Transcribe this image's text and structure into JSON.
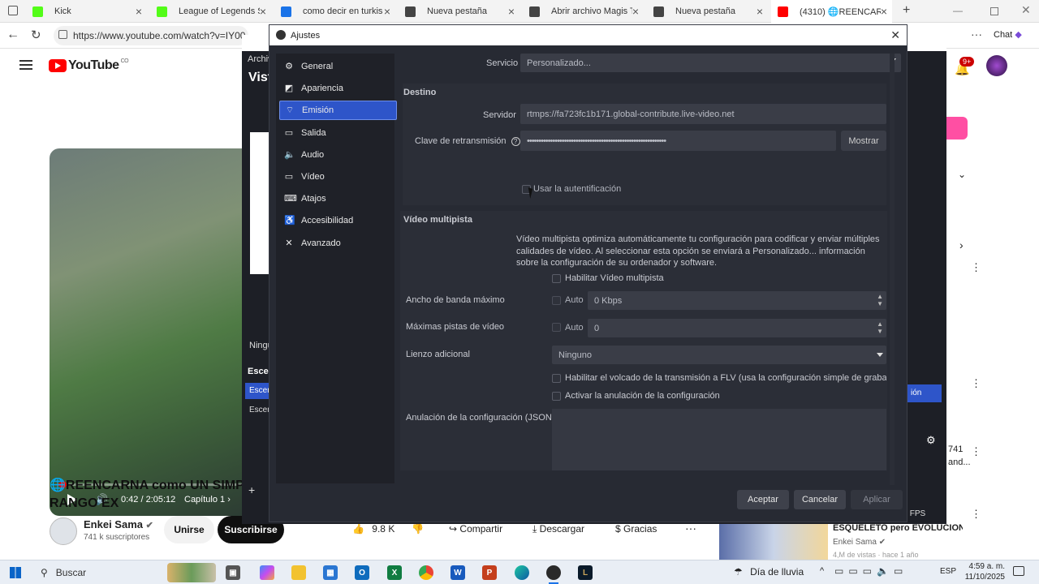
{
  "browser": {
    "tabs": [
      {
        "label": "Kick",
        "icon": "kick-icon",
        "color": "#53fc18"
      },
      {
        "label": "League of Legends Stre",
        "icon": "kick-icon",
        "color": "#53fc18"
      },
      {
        "label": "como decir en turkis no",
        "icon": "search-icon",
        "color": "#1a73e8"
      },
      {
        "label": "Nueva pestaña",
        "icon": "page-icon",
        "color": "#444444"
      },
      {
        "label": "Abrir archivo Magis TV",
        "icon": "globe-icon",
        "color": "#444444"
      },
      {
        "label": "Nueva pestaña",
        "icon": "page-icon",
        "color": "#444444"
      },
      {
        "label": "(4310) 🌐REENCARNA c",
        "icon": "youtube-icon",
        "color": "#ff0000"
      }
    ],
    "url": "https://www.youtube.com/watch?v=IY00_",
    "chat_label": "Chat"
  },
  "youtube": {
    "logo": "YouTube",
    "country_code": "CO",
    "notif_count": "9+",
    "video_time": "0:42 / 2:05:12",
    "chapter": "Capítulo 1",
    "title_line1": "🌐REENCARNA como UN SIMPL",
    "title_line2": "RANGO EX",
    "channel": "Enkei Sama",
    "subscribers": "741 k suscriptores",
    "join_label": "Unirse",
    "subscribe_label": "Suscribirse",
    "likes": "9.8 K",
    "share_label": "Compartir",
    "download_label": "Descargar",
    "thanks_label": "Gracias",
    "rec_title": "ESQUELETO pero EVOLUCION...",
    "rec_channel": "Enkei Sama",
    "rec_meta": "4,M de vistas · hace 1 año",
    "side_count": "741",
    "side_count2": "and..."
  },
  "obs": {
    "menu_label": "Archiv",
    "vista_label": "Vist",
    "ninguno_label": "Ningu",
    "escenas_label": "Escen",
    "scene1": "Escen",
    "scene2": "Escen",
    "fps_label": "FPS",
    "side_button": "ión"
  },
  "dialog": {
    "title": "Ajustes",
    "nav": [
      {
        "label": "General",
        "icon": "gear-icon",
        "glyph": "⚙"
      },
      {
        "label": "Apariencia",
        "icon": "appearance-icon",
        "glyph": "◩"
      },
      {
        "label": "Emisión",
        "icon": "broadcast-icon",
        "glyph": "⌔"
      },
      {
        "label": "Salida",
        "icon": "output-icon",
        "glyph": "▭"
      },
      {
        "label": "Audio",
        "icon": "speaker-icon",
        "glyph": "🔈"
      },
      {
        "label": "Vídeo",
        "icon": "monitor-icon",
        "glyph": "▭"
      },
      {
        "label": "Atajos",
        "icon": "keyboard-icon",
        "glyph": "⌨"
      },
      {
        "label": "Accesibilidad",
        "icon": "accessibility-icon",
        "glyph": "♿"
      },
      {
        "label": "Avanzado",
        "icon": "tools-icon",
        "glyph": "✕"
      }
    ],
    "service_label": "Servicio",
    "service_value": "Personalizado...",
    "destino_header": "Destino",
    "server_label": "Servidor",
    "server_value": "rtmps://fa723fc1b171.global-contribute.live-video.net",
    "key_label": "Clave de retransmisión",
    "key_value": "••••••••••••••••••••••••••••••••••••••••••••••••••••••••••••",
    "show_label": "Mostrar",
    "auth_label": "Usar la autentificación",
    "multitrack_header": "Vídeo multipista",
    "multitrack_desc": "Vídeo multipista optimiza automáticamente tu configuración para codificar y enviar múltiples calidades de vídeo. Al seleccionar esta opción se enviará a Personalizado... información sobre la configuración de su ordenador y software.",
    "enable_multitrack_label": "Habilitar Vídeo multipista",
    "max_bw_label": "Ancho de banda máximo",
    "auto_label": "Auto",
    "max_bw_value": "0 Kbps",
    "max_tracks_label": "Máximas pistas de vídeo",
    "max_tracks_value": "0",
    "extra_canvas_label": "Lienzo adicional",
    "extra_canvas_value": "Ninguno",
    "flv_label": "Habilitar el volcado de la transmisión a FLV (usa la configuración simple de grabació",
    "override_label": "Activar la anulación de la configuración",
    "json_label": "Anulación de la configuración (JSON)",
    "accept_label": "Aceptar",
    "cancel_label": "Cancelar",
    "apply_label": "Aplicar"
  },
  "taskbar": {
    "search_label": "Buscar",
    "weather_label": "Día de lluvia",
    "lang_label": "ESP",
    "time": "4:59 a. m.",
    "date": "11/10/2025"
  }
}
